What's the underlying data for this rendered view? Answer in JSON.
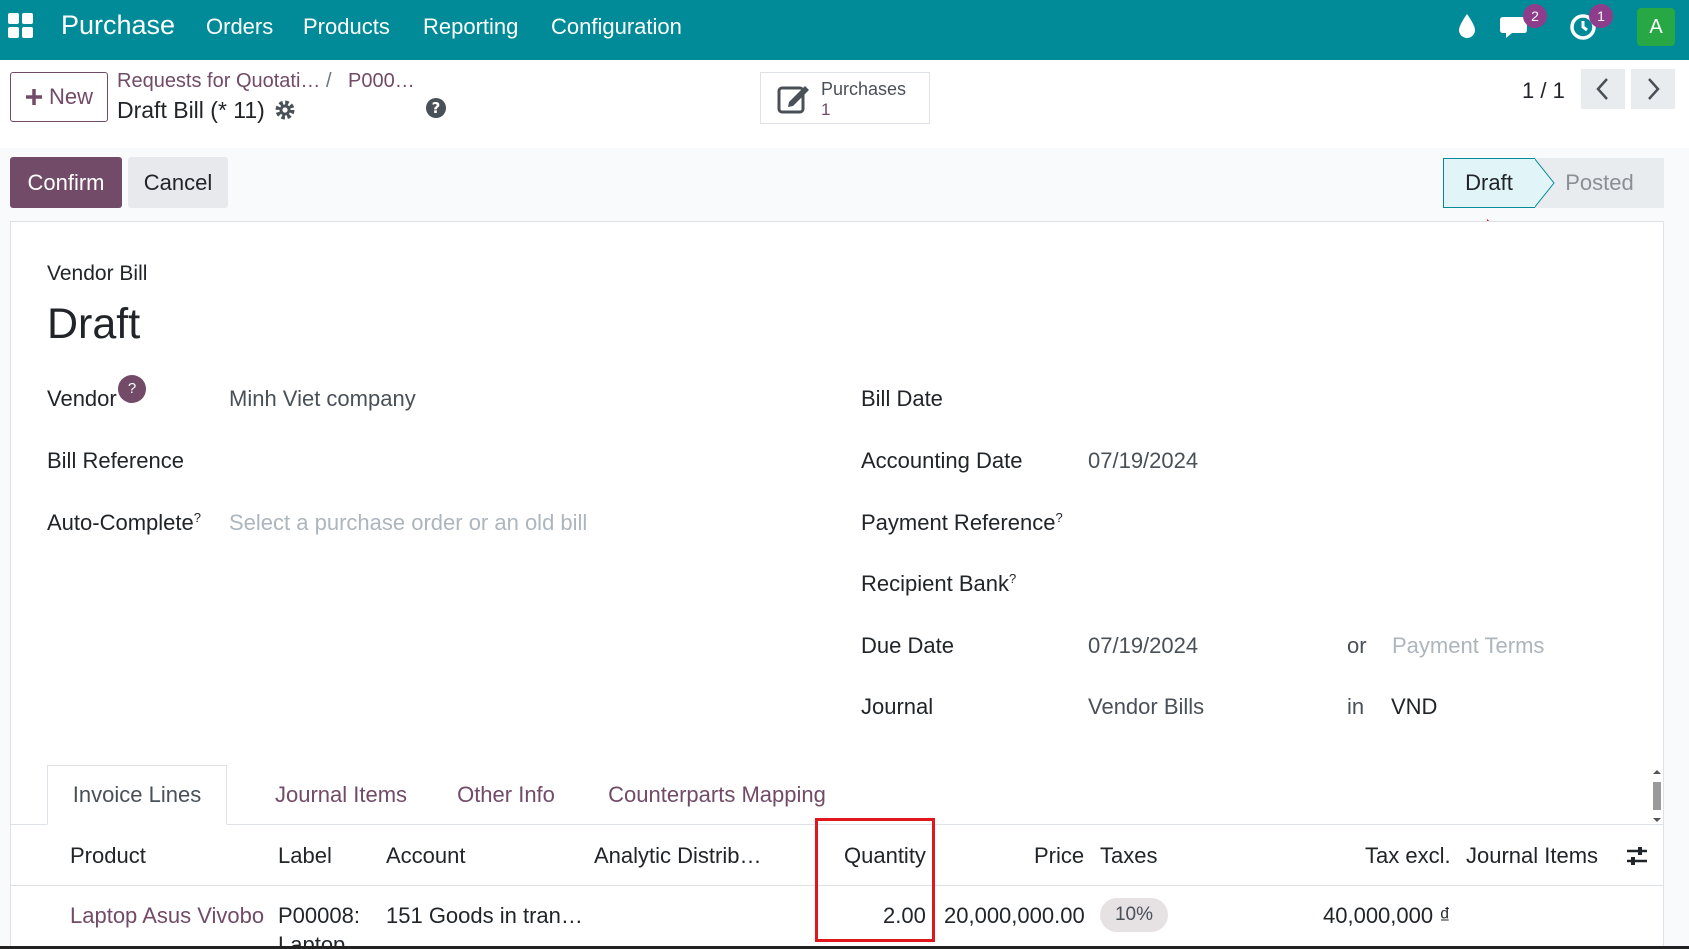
{
  "navbar": {
    "app_name": "Purchase",
    "menu": [
      "Orders",
      "Products",
      "Reporting",
      "Configuration"
    ],
    "icons": [
      "apps-grid-icon",
      "drop-icon",
      "chat-icon",
      "clock-icon"
    ],
    "messages_count": "2",
    "activities_count": "1",
    "avatar_letter": "A"
  },
  "control_panel": {
    "new_label": "New",
    "breadcrumb_parent": "Requests for Quotati…",
    "breadcrumb_sep": "/",
    "breadcrumb_child": "P000…",
    "record_title": "Draft Bill (* 11)",
    "smart_button": {
      "label": "Purchases",
      "value": "1"
    },
    "pager": "1 / 1"
  },
  "actions": {
    "confirm_label": "Confirm",
    "cancel_label": "Cancel"
  },
  "statusbar": {
    "stages": [
      "Draft",
      "Posted"
    ],
    "active": "Draft"
  },
  "form": {
    "doc_type": "Vendor Bill",
    "title": "Draft",
    "left_fields": {
      "vendor_label": "Vendor",
      "vendor_help": "?",
      "vendor_value": "Minh Viet company",
      "bill_ref_label": "Bill Reference",
      "autocomplete_label": "Auto-Complete",
      "autocomplete_placeholder": "Select a purchase order or an old bill"
    },
    "right_fields": {
      "bill_date_label": "Bill Date",
      "accounting_date_label": "Accounting Date",
      "accounting_date_value": "07/19/2024",
      "payment_ref_label": "Payment Reference",
      "recipient_bank_label": "Recipient Bank",
      "due_date_label": "Due Date",
      "due_date_value": "07/19/2024",
      "due_or": "or",
      "payment_terms_placeholder": "Payment Terms",
      "journal_label": "Journal",
      "journal_value": "Vendor Bills",
      "journal_in": "in",
      "currency_value": "VND"
    },
    "help_mark": "?"
  },
  "tabs": [
    "Invoice Lines",
    "Journal Items",
    "Other Info",
    "Counterparts Mapping"
  ],
  "invoice_lines": {
    "columns": [
      "Product",
      "Label",
      "Account",
      "Analytic Distrib…",
      "Quantity",
      "Price",
      "Taxes",
      "Tax excl.",
      "Journal Items"
    ],
    "rows": [
      {
        "product": "Laptop Asus Vivobo",
        "label": "P00008:",
        "label_more": "Laptop",
        "account": "151 Goods in tran…",
        "quantity": "2.00",
        "price": "20,000,000.00",
        "tax": "10%",
        "tax_excl": "40,000,000 ₫"
      }
    ]
  },
  "colors": {
    "navbar": "#018a97",
    "primary": "#714b67",
    "highlight_box": "#e0181b"
  }
}
